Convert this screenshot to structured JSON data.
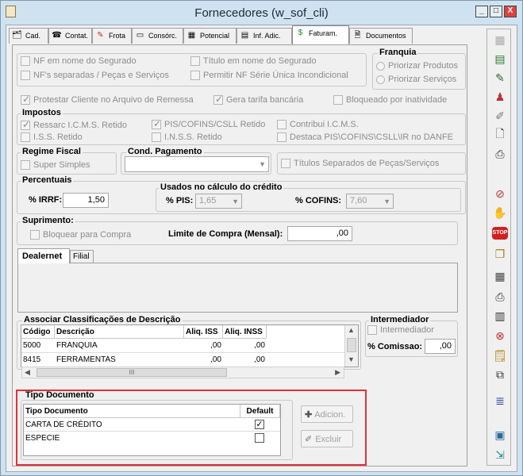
{
  "window": {
    "title": "Fornecedores (w_sof_cli)",
    "min": "_",
    "max": "□",
    "close": "X"
  },
  "tabs": [
    {
      "label": "Cad."
    },
    {
      "label": "Contat."
    },
    {
      "label": "Frota"
    },
    {
      "label": "Consórc."
    },
    {
      "label": "Potencial"
    },
    {
      "label": "Inf. Adic."
    },
    {
      "label": "Faturam."
    },
    {
      "label": "Documentos"
    }
  ],
  "flags": {
    "nf_nome_segurado": "NF em nome do Segurado",
    "titulo_nome_segurado": "Título em nome do Segurado",
    "nfs_separadas": "NF's separadas / Peças e Serviços",
    "permitir_nf": "Permitir NF Série Única Incondicional"
  },
  "franquia": {
    "title": "Franquia",
    "opt1": "Priorizar Produtos",
    "opt2": "Priorizar Serviços"
  },
  "protestar": "Protestar Cliente no Arquivo de Remessa",
  "gera_tarifa": "Gera tarifa bancária",
  "bloqueado_inatividade": "Bloqueado por inatividade",
  "impostos": {
    "title": "Impostos",
    "ressarc": "Ressarc I.C.M.S. Retido",
    "pis": "PIS/COFINS/CSLL Retido",
    "contribui": "Contribui I.C.M.S.",
    "iss": "I.S.S. Retido",
    "inss": "I.N.S.S. Retido",
    "destaca": "Destaca PIS\\COFINS\\CSLL\\IR no DANFE"
  },
  "regime": {
    "title": "Regime Fiscal",
    "super_simples": "Super Simples"
  },
  "cond_pagamento": {
    "title": "Cond. Pagamento",
    "value": ""
  },
  "titulos_separados": "Títulos Separados de Peças/Serviços",
  "percentuais": {
    "title": "Percentuais",
    "irrf_label": "% IRRF:",
    "irrf_value": "1,50",
    "usados_title": "Usados no cálculo do crédito",
    "pis_label": "% PIS:",
    "pis_value": "1,65",
    "cofins_label": "% COFINS:",
    "cofins_value": "7,60"
  },
  "suprimento": {
    "title": "Suprimento:",
    "bloquear": "Bloquear para Compra",
    "limite_label": "Limite de Compra (Mensal):",
    "limite_value": ",00"
  },
  "subtabs": [
    {
      "label": "Dealernet"
    },
    {
      "label": "Filial"
    }
  ],
  "classificacoes": {
    "title": "Associar Classificações de Descrição",
    "headers": [
      "Código",
      "Descrição",
      "Aliq. ISS",
      "Aliq. INSS"
    ],
    "rows": [
      {
        "codigo": "5000",
        "descricao": "FRANQUIA",
        "iss": ",00",
        "inss": ",00"
      },
      {
        "codigo": "8415",
        "descricao": "FERRAMENTAS",
        "iss": ",00",
        "inss": ",00"
      }
    ],
    "hscroll": "III"
  },
  "intermediador": {
    "title": "Intermediador",
    "check": "Intermediador",
    "comissao_label": "% Comissao:",
    "comissao_value": ",00"
  },
  "tipo_documento": {
    "title": "Tipo Documento",
    "headers": [
      "Tipo Documento",
      "Default"
    ],
    "rows": [
      {
        "tipo": "CARTA DE CRÉDITO",
        "default": true
      },
      {
        "tipo": "ESPECIE",
        "default": false
      }
    ],
    "adicionar": "Adicion.",
    "excluir": "Excluir"
  },
  "colors": {
    "highlight": "#e0313c",
    "title_bar": "#cfe2ef"
  }
}
